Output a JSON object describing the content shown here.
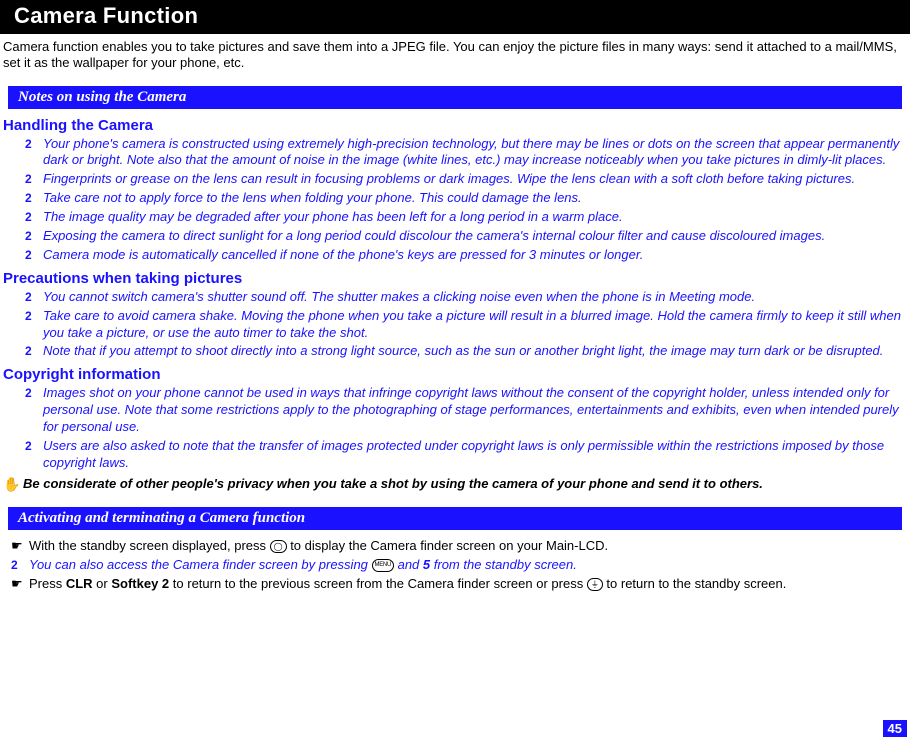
{
  "title": "Camera Function",
  "intro": "Camera function enables you to take pictures and save them into a JPEG file. You can enjoy the picture files in many ways: send it attached to a mail/MMS, set it as the wallpaper for your phone, etc.",
  "section1": {
    "heading": "Notes on using the Camera",
    "sub1": {
      "heading": "Handling the Camera",
      "bullets": [
        "Your phone's camera is constructed using extremely high-precision technology, but there may be lines or dots on the screen that appear permanently dark or bright. Note also that the amount of noise in the image (white lines, etc.) may increase noticeably when you take pictures in dimly-lit places.",
        "Fingerprints or grease on the lens can result in focusing problems or dark images. Wipe the lens clean with a soft cloth before taking pictures.",
        "Take care not to apply force to the lens when folding your phone. This could damage the lens.",
        "The image quality may be degraded after your phone has been left for a long period in a warm place.",
        "Exposing the camera to direct sunlight for a long period could discolour the camera's internal colour filter and cause discoloured images.",
        "Camera mode is automatically cancelled if none of the phone's keys are pressed for 3 minutes or longer."
      ]
    },
    "sub2": {
      "heading": "Precautions when taking pictures",
      "bullets": [
        "You cannot switch camera's shutter sound off. The shutter makes a clicking noise even when the phone is in Meeting mode.",
        "Take care to avoid camera shake. Moving the phone when you take a picture will result in a blurred image. Hold the camera firmly to keep it still when you take a picture, or use the auto timer to take the shot.",
        "Note that if you attempt to shoot directly into a strong light source, such as the sun or another bright light, the image may turn dark or be disrupted."
      ]
    },
    "sub3": {
      "heading": "Copyright information",
      "bullets": [
        "Images shot on your phone cannot be used in ways that infringe copyright laws without the consent of the copyright holder, unless intended only for personal use. Note that some restrictions apply to the photographing of stage performances, entertainments and exhibits, even when intended purely for personal use.",
        "Users are also asked to note that the transfer of images protected under copyright laws is only permissible within the restrictions imposed by those copyright laws."
      ]
    },
    "handnote": "Be considerate of other people's privacy when you take a shot by using the camera of your phone and send it to others."
  },
  "section2": {
    "heading": "Activating and terminating a Camera function",
    "line1_pre": "With the standby screen displayed, press ",
    "line1_post": " to display the Camera finder screen on your Main-LCD.",
    "line2_pre": "You can also access the Camera finder screen by pressing ",
    "line2_mid": " and ",
    "line2_key": "5",
    "line2_post": " from the standby screen.",
    "line3_pre": "Press ",
    "line3_b1": "CLR",
    "line3_mid1": " or ",
    "line3_b2": "Softkey 2",
    "line3_mid2": " to return to the previous screen from the Camera finder screen or press ",
    "line3_post": " to return to the standby screen."
  },
  "page": "45",
  "markers": {
    "book": "2",
    "hand": "✋",
    "pointer": "☛"
  },
  "icons": {
    "circle": "◯",
    "menu": "MENU",
    "end": "⏚"
  }
}
